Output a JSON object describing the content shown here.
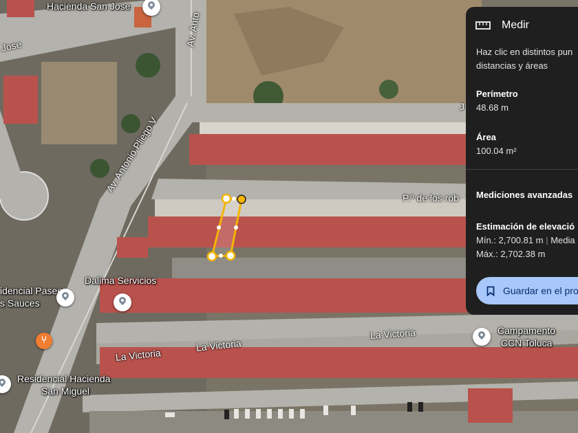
{
  "map": {
    "labels": {
      "hacienda_san_jose": "Hacienda San Jose",
      "jose": "Jose",
      "av_antonio": "Av. Anto",
      "av_antonio_pliego": "Av. Antonio Pliego V",
      "p_de_los_robles": "P.º de los rob",
      "dalima_servicios": "Dalima Servicios",
      "residencial_paseo_1": "idencial Paseo",
      "residencial_paseo_2": "s Sauces",
      "la_victoria_1": "La Victoria",
      "la_victoria_2": "La Victoria",
      "la_victoria_3": "La Victoria",
      "campamento_1": "Campamento",
      "campamento_2": "CCN Toluca",
      "residencial_hacienda_1": "Residencial Hacienda",
      "residencial_hacienda_2": "San Miguel",
      "j_edge": "J"
    },
    "colors": {
      "measure_line": "#f5b400",
      "roof": "#b9524d",
      "road": "#b4b2ac"
    }
  },
  "panel": {
    "title": "Medir",
    "icon": "ruler-icon",
    "instructions_1": "Haz clic en distintos pun",
    "instructions_2": "distancias y áreas",
    "perimeter_label": "Perímetro",
    "perimeter_value": "48.68 m",
    "area_label": "Área",
    "area_value": "100.04 m²",
    "advanced_label": "Mediciones avanzadas",
    "elevation_label": "Estimación de elevació",
    "elevation_min": "Mín.: 2,700.81 m",
    "elevation_mid_sep": "|",
    "elevation_mid": "Media",
    "elevation_max": "Máx.: 2,702.38 m",
    "save_label": "Guardar en el pro",
    "save_icon": "bookmark-icon"
  }
}
